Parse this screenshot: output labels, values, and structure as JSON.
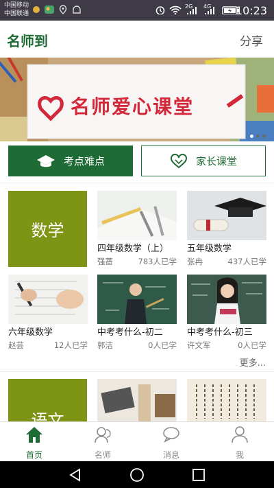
{
  "status_bar": {
    "carrier1": "中国移动",
    "carrier2": "中国联通",
    "network": "4G",
    "network2": "2G",
    "time": "10:23"
  },
  "header": {
    "title": "名师到",
    "share_label": "分享"
  },
  "banner": {
    "text": "名师爱心课堂"
  },
  "tabs": [
    {
      "label": "考点难点",
      "icon": "graduation-cap-icon"
    },
    {
      "label": "家长课堂",
      "icon": "heart-icon"
    }
  ],
  "sections": [
    {
      "subject": "数学",
      "courses": [
        {
          "title": "四年级数学（上）",
          "teacher": "强蔷",
          "learners": "783人已学"
        },
        {
          "title": "五年级数学",
          "teacher": "张冉",
          "learners": "437人已学"
        },
        {
          "title": "六年级数学",
          "teacher": "赵芸",
          "learners": "12人已学"
        },
        {
          "title": "中考考什么-初二",
          "teacher": "郭洁",
          "learners": "0人已学"
        },
        {
          "title": "中考考什么-初三",
          "teacher": "许文军",
          "learners": "0人已学"
        }
      ],
      "more_label": "更多..."
    },
    {
      "subject": "语文"
    }
  ],
  "bottom_nav": [
    {
      "label": "首页",
      "icon": "home-icon",
      "active": true
    },
    {
      "label": "名师",
      "icon": "teacher-icon",
      "active": false
    },
    {
      "label": "消息",
      "icon": "message-icon",
      "active": false
    },
    {
      "label": "我",
      "icon": "profile-icon",
      "active": false
    }
  ],
  "colors": {
    "brand_green": "#1f6b35",
    "subject_green": "#7d9414",
    "status_bar": "#3f3b46"
  }
}
